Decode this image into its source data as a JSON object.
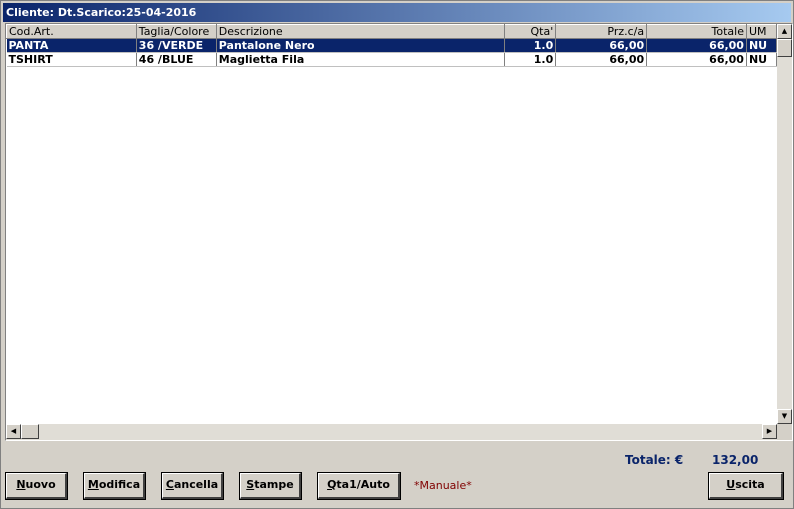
{
  "window": {
    "title": "Cliente: Dt.Scarico:25-04-2016"
  },
  "grid": {
    "columns": [
      "Cod.Art.",
      "Taglia/Colore",
      "Descrizione",
      "Qta'",
      "Prz.c/a",
      "Totale",
      "UM"
    ],
    "rows": [
      {
        "cod": "PANTA",
        "taglia": "36 /VERDE",
        "descrizione": "Pantalone Nero",
        "qta": "1.0",
        "prezzo": "66,00",
        "totale": "66,00",
        "um": "NU",
        "selected": true
      },
      {
        "cod": "TSHIRT",
        "taglia": "46 /BLUE",
        "descrizione": "Maglietta Fila",
        "qta": "1.0",
        "prezzo": "66,00",
        "totale": "66,00",
        "um": "NU",
        "selected": false
      }
    ]
  },
  "summary": {
    "total_label": "Totale: €",
    "total_value": "132,00"
  },
  "buttons": {
    "nuovo": {
      "hotkey": "N",
      "rest": "uovo"
    },
    "modifica": {
      "hotkey": "M",
      "rest": "odifica"
    },
    "cancella": {
      "hotkey": "C",
      "rest": "ancella"
    },
    "stampe": {
      "hotkey": "S",
      "rest": "tampe"
    },
    "qta": {
      "hotkey": "Q",
      "rest": "ta1/Auto"
    },
    "uscita": {
      "hotkey": "U",
      "rest": "scita"
    }
  },
  "mode_label": "*Manuale*",
  "icons": {
    "scroll_up": "triangle-up",
    "scroll_down": "triangle-down",
    "scroll_left": "triangle-left",
    "scroll_right": "triangle-right"
  },
  "colors": {
    "selection": "#0a246a",
    "total_text": "#0a246a",
    "mode_text": "#800000"
  }
}
